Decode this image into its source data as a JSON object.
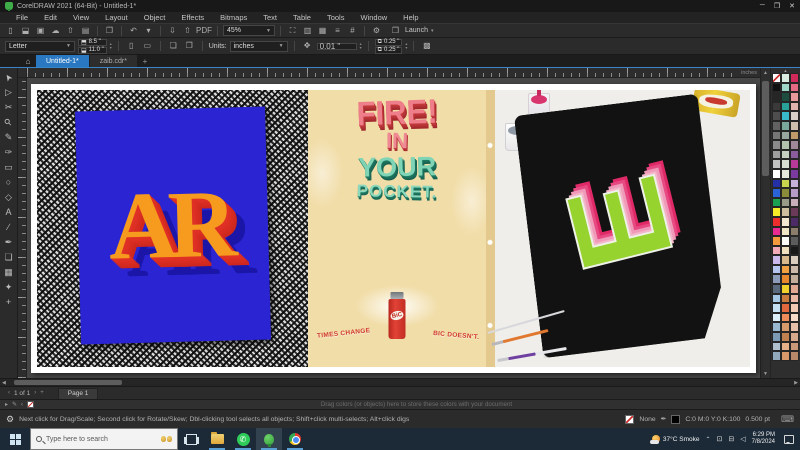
{
  "titlebar": {
    "title": "CorelDRAW 2021 (64-Bit) - Untitled-1*"
  },
  "window_controls": {
    "minimize": "─",
    "maximize": "❐",
    "close": "✕"
  },
  "menubar": {
    "items": [
      "File",
      "Edit",
      "View",
      "Layout",
      "Object",
      "Effects",
      "Bitmaps",
      "Text",
      "Table",
      "Tools",
      "Window",
      "Help"
    ]
  },
  "toolbar": {
    "zoom_level": "45%",
    "launch_label": "Launch",
    "pdf_label": "PDF"
  },
  "property_bar": {
    "page_size": "Letter",
    "page_width": "8.5 \"",
    "page_height": "11.0 \"",
    "units_label": "Units:",
    "units_value": "inches",
    "nudge_distance": "0.01 \"",
    "duplicate_x": "0.25 \"",
    "duplicate_y": "0.25 \""
  },
  "tabs": {
    "home_glyph": "⌂",
    "items": [
      {
        "name": "tab-untitled-1",
        "label": "Untitled-1*",
        "active": true
      },
      {
        "name": "tab-zaib-cdr",
        "label": "zaib.cdr*",
        "active": false
      }
    ],
    "add_glyph": "+"
  },
  "ruler": {
    "unit_label": "inches"
  },
  "toolbox": {
    "tools": [
      {
        "name": "pick-tool",
        "glyph": "➤"
      },
      {
        "name": "shape-tool",
        "glyph": "▷"
      },
      {
        "name": "crop-tool",
        "glyph": "✂"
      },
      {
        "name": "zoom-tool",
        "glyph": "⚲"
      },
      {
        "name": "freehand-tool",
        "glyph": "✎"
      },
      {
        "name": "artistic-media-tool",
        "glyph": "✑"
      },
      {
        "name": "rectangle-tool",
        "glyph": "▭"
      },
      {
        "name": "ellipse-tool",
        "glyph": "○"
      },
      {
        "name": "polygon-tool",
        "glyph": "◇"
      },
      {
        "name": "text-tool",
        "glyph": "A"
      },
      {
        "name": "dimension-tool",
        "glyph": "∕"
      },
      {
        "name": "pen-tool",
        "glyph": "✒"
      },
      {
        "name": "drop-shadow-tool",
        "glyph": "❏"
      },
      {
        "name": "transparency-tool",
        "glyph": "▦"
      },
      {
        "name": "eyedropper-tool",
        "glyph": "✦"
      },
      {
        "name": "add-tool-button",
        "glyph": "+"
      }
    ]
  },
  "canvas": {
    "image1": {
      "letters": "AR"
    },
    "image2": {
      "line1": "FIRE!",
      "line2": "IN",
      "line3": "YOUR",
      "line4": "POCKET.",
      "lighter_brand": "BiC",
      "banner_left": "TIMES CHANGE",
      "banner_right": "BIC DOESN'T."
    },
    "image3": {
      "letter": "E"
    }
  },
  "palette": {
    "colors": [
      "none",
      "#d8ece2",
      "#d1295a",
      "#111111",
      "#9fd8c8",
      "#e56a84",
      "#262626",
      "#1e4d40",
      "#e89a9a",
      "#3a3a3a",
      "#2aa198",
      "#e0b4ac",
      "#4e4e4e",
      "#38b8c8",
      "#d8cfc8",
      "#626262",
      "#7aa89a",
      "#cfc0ae",
      "#767676",
      "#97a7a0",
      "#c09a68",
      "#8a8a8a",
      "#b2c4ae",
      "#a08898",
      "#9e9e9e",
      "#c4cfc0",
      "#8a5c9c",
      "#c2c2c2",
      "#d8dfd2",
      "#b83a98",
      "#ffffff",
      "#e6eadd",
      "#7a3aa0",
      "#2330a6",
      "#c6d44e",
      "#c4b0d8",
      "#2a62d8",
      "#8a8c3a",
      "#b89cc8",
      "#19a050",
      "#9a9a88",
      "#c8aeba",
      "#f5ec28",
      "#ccbe9e",
      "#6a3a58",
      "#ee2e2c",
      "#f2e8d2",
      "#4c2a66",
      "#ea2a90",
      "#efe6c6",
      "#8c7c6c",
      "#f29a3c",
      "#fbfbf8",
      "#5c5c5c",
      "#f2aab8",
      "#f0e0c0",
      "#181818",
      "#cbb8ea",
      "#d8b88a",
      "#d8ccbe",
      "#b4c4ec",
      "#f0a040",
      "#ccb8a8",
      "#8c9cb8",
      "#e8882e",
      "#c2ac9a",
      "#5a6a7c",
      "#f2d02c",
      "#e0a890",
      "#a6c8e2",
      "#ca7a3c",
      "#eab8a2",
      "#c6e0f2",
      "#e2683e",
      "#f2cab4",
      "#dceef8",
      "#ee8c5a",
      "#f8dcc8",
      "#98b8d0",
      "#d89a6a",
      "#e8c0aa",
      "#7c9ab4",
      "#c08050",
      "#d8a88c",
      "#b0c0cc",
      "#e8b088",
      "#c89878",
      "#90a8ba",
      "#d8986a",
      "#b8886a"
    ]
  },
  "page_nav": {
    "current": "1 of 1",
    "add_glyph": "+",
    "page_tab_label": "Page 1"
  },
  "doc_palette": {
    "hint": "Drag colors (or objects) here to store these colors with your document"
  },
  "status_bar": {
    "hint": "Next click for Drag/Scale; Second click for Rotate/Skew; Dbl-clicking tool selects all objects; Shift+click multi-selects; Alt+click digs",
    "fill_label": "None",
    "outline_color": "C:0 M:0 Y:0 K:100",
    "outline_width": "0.500 pt"
  },
  "taskbar": {
    "search_placeholder": "Type here to search",
    "weather": "37°C Smoke",
    "time": "6:29 PM",
    "date": "7/8/2024"
  },
  "colors": {
    "accent_blue": "#2a78c2",
    "canvas_blue": "#2a24d2",
    "poster_cream": "#f1dda8",
    "lime": "#96d32e",
    "magenta": "#e02a68"
  }
}
